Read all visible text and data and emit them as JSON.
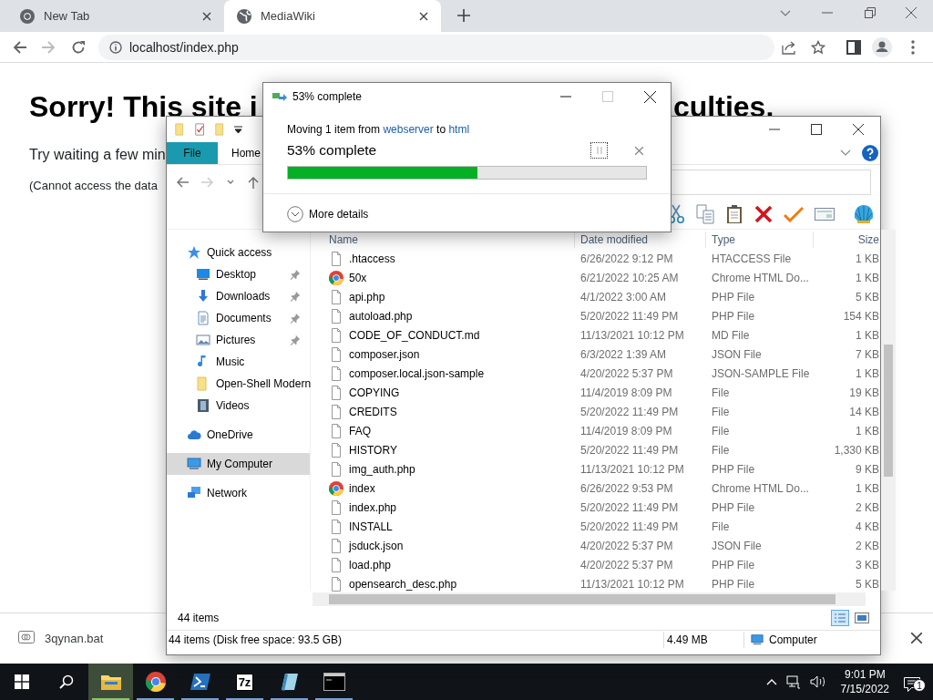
{
  "browser": {
    "tabs": [
      {
        "title": "New Tab",
        "kind": "newtab",
        "selected": false
      },
      {
        "title": "MediaWiki",
        "kind": "site",
        "selected": true
      }
    ],
    "address": "localhost/index.php",
    "page": {
      "heading_start": "Sorry! This site i",
      "heading_end": "culties.",
      "paragraph": "Try waiting a few min",
      "note": "(Cannot access the data"
    },
    "download": {
      "filename": "3qynan.bat"
    }
  },
  "explorer": {
    "ribbon_tabs": [
      {
        "label": "File",
        "kind": "file"
      },
      {
        "label": "Home",
        "kind": "tab"
      }
    ],
    "nav": [
      {
        "label": "Quick access",
        "kind": "star",
        "selected": false,
        "children": [
          {
            "label": "Desktop",
            "kind": "desktop",
            "pinned": true
          },
          {
            "label": "Downloads",
            "kind": "download",
            "pinned": true
          },
          {
            "label": "Documents",
            "kind": "documents",
            "pinned": true
          },
          {
            "label": "Pictures",
            "kind": "pictures",
            "pinned": true
          },
          {
            "label": "Music",
            "kind": "music"
          },
          {
            "label": "Open-Shell Modern",
            "kind": "folder"
          },
          {
            "label": "Videos",
            "kind": "videos"
          }
        ]
      },
      {
        "label": "OneDrive",
        "kind": "cloud",
        "selected": false
      },
      {
        "label": "My Computer",
        "kind": "computer",
        "selected": true
      },
      {
        "label": "Network",
        "kind": "network",
        "selected": false
      }
    ],
    "columns": [
      "Name",
      "Date modified",
      "Type",
      "Size"
    ],
    "rows": [
      {
        "kind": "file",
        "name": ".htaccess",
        "date": "6/26/2022 9:12 PM",
        "type": "HTACCESS File",
        "size": "1 KB"
      },
      {
        "kind": "chrome",
        "name": "50x",
        "date": "6/21/2022 10:25 AM",
        "type": "Chrome HTML Do...",
        "size": "1 KB"
      },
      {
        "kind": "file",
        "name": "api.php",
        "date": "4/1/2022 3:00 AM",
        "type": "PHP File",
        "size": "5 KB"
      },
      {
        "kind": "file",
        "name": "autoload.php",
        "date": "5/20/2022 11:49 PM",
        "type": "PHP File",
        "size": "154 KB"
      },
      {
        "kind": "file",
        "name": "CODE_OF_CONDUCT.md",
        "date": "11/13/2021 10:12 PM",
        "type": "MD File",
        "size": "1 KB"
      },
      {
        "kind": "file",
        "name": "composer.json",
        "date": "6/3/2022 1:39 AM",
        "type": "JSON File",
        "size": "7 KB"
      },
      {
        "kind": "file",
        "name": "composer.local.json-sample",
        "date": "4/20/2022 5:37 PM",
        "type": "JSON-SAMPLE File",
        "size": "1 KB"
      },
      {
        "kind": "file",
        "name": "COPYING",
        "date": "11/4/2019 8:09 PM",
        "type": "File",
        "size": "19 KB"
      },
      {
        "kind": "file",
        "name": "CREDITS",
        "date": "5/20/2022 11:49 PM",
        "type": "File",
        "size": "14 KB"
      },
      {
        "kind": "file",
        "name": "FAQ",
        "date": "11/4/2019 8:09 PM",
        "type": "File",
        "size": "1 KB"
      },
      {
        "kind": "file",
        "name": "HISTORY",
        "date": "5/20/2022 11:49 PM",
        "type": "File",
        "size": "1,330 KB"
      },
      {
        "kind": "file",
        "name": "img_auth.php",
        "date": "11/13/2021 10:12 PM",
        "type": "PHP File",
        "size": "9 KB"
      },
      {
        "kind": "chrome",
        "name": "index",
        "date": "6/26/2022 9:53 PM",
        "type": "Chrome HTML Do...",
        "size": "1 KB"
      },
      {
        "kind": "file",
        "name": "index.php",
        "date": "5/20/2022 11:49 PM",
        "type": "PHP File",
        "size": "2 KB"
      },
      {
        "kind": "file",
        "name": "INSTALL",
        "date": "5/20/2022 11:49 PM",
        "type": "File",
        "size": "4 KB"
      },
      {
        "kind": "file",
        "name": "jsduck.json",
        "date": "4/20/2022 5:37 PM",
        "type": "JSON File",
        "size": "2 KB"
      },
      {
        "kind": "file",
        "name": "load.php",
        "date": "4/20/2022 5:37 PM",
        "type": "PHP File",
        "size": "3 KB"
      },
      {
        "kind": "file",
        "name": "opensearch_desc.php",
        "date": "11/13/2021 10:12 PM",
        "type": "PHP File",
        "size": "5 KB"
      }
    ],
    "item_count": "44 items",
    "status": {
      "summary": "44 items (Disk free space: 93.5 GB)",
      "size": "4.49 MB",
      "location": "Computer"
    }
  },
  "dialog": {
    "title": "53% complete",
    "message_prefix": "Moving 1 item from",
    "source": "webserver",
    "message_middle": "to",
    "destination": "html",
    "progress_text": "53% complete",
    "level": 0.53,
    "more_details": "More details"
  },
  "taskbar": {
    "apps": [
      {
        "kind": "explorer",
        "active": true,
        "running": true
      },
      {
        "kind": "chrome",
        "active": false,
        "running": true
      },
      {
        "kind": "powershell",
        "active": false,
        "running": true
      },
      {
        "kind": "archiver",
        "label": "7z",
        "active": false,
        "running": true
      },
      {
        "kind": "notes",
        "active": false,
        "running": true
      },
      {
        "kind": "terminal",
        "active": false,
        "running": true
      }
    ],
    "time": "9:01 PM",
    "date": "7/15/2022",
    "notifications": "1"
  }
}
